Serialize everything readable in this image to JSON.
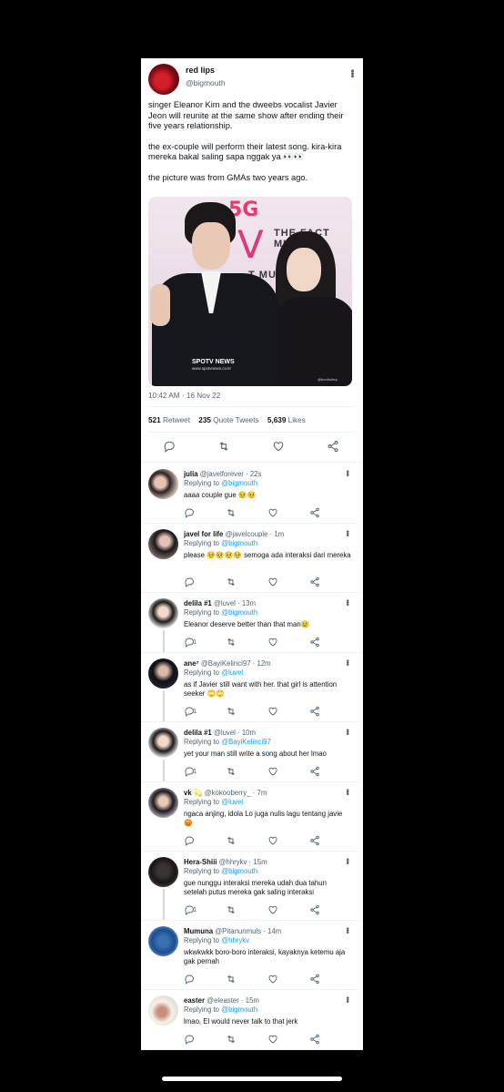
{
  "tweet": {
    "display_name": "red lips",
    "handle": "@bigmouth",
    "paragraphs": [
      "singer Eleanor Kim and the dweebs vocalist Javier Jeon will reunite at the same show after ending their five years relationship.",
      "the ex-couple will perform their latest song. kira-kira mereka bakal saling sapa nggak ya 👀👀",
      "the picture was from GMAs two years ago."
    ],
    "photo": {
      "logo_5g": "5G",
      "logo_v": "V",
      "backdrop_text_1": "THE FACT MUS",
      "backdrop_text_2": "T MUSI",
      "caption": "SPOTV NEWS",
      "caption_sub": "www.spotvnews.co.kr",
      "credit": "@bonfruitep"
    },
    "timestamp": "10:42 AM · 16 Nov 22",
    "stats": {
      "retweets": "521",
      "retweets_label": "Retweet",
      "quotes": "235",
      "quotes_label": "Quote Tweets",
      "likes": "5,639",
      "likes_label": "Likes"
    }
  },
  "replies": [
    {
      "name": "julia",
      "handle": "@javelforever",
      "time": "· 22s",
      "replying_prefix": "Replying to",
      "replying_to": "@bigmouth",
      "text": "aaaa couple gue 🥺🥺",
      "reply_count": ""
    },
    {
      "name": "javel for life",
      "handle": "@javelcouple",
      "time": "· 1m",
      "replying_prefix": "Replying to",
      "replying_to": "@bigmouth",
      "text": "please 🥺🥺🥺🥺 semoga ada interaksi dari mereka",
      "reply_count": ""
    },
    {
      "name": "delila #1",
      "handle": "@luvel",
      "time": "· 13m",
      "replying_prefix": "Replying to",
      "replying_to": "@bigmouth",
      "text": "Eleanor deserve better than that man😢",
      "reply_count": "1"
    },
    {
      "name": "ane⁷",
      "handle": "@BayiKelinci97",
      "time": "· 12m",
      "replying_prefix": "Replying to",
      "replying_to": "@luvel",
      "text": "as if Javier still want with her. that girl is attention seeker 🙄🙄",
      "reply_count": "1"
    },
    {
      "name": "delila #1",
      "handle": "@luvel",
      "time": "· 10m",
      "replying_prefix": "Replying to",
      "replying_to": "@BayiKelinci97",
      "text": "yet your man still write a song about her lmao",
      "reply_count": "1"
    },
    {
      "name": "vk 💫",
      "handle": "@kokooberry_",
      "time": "· 7m",
      "replying_prefix": "Replying to",
      "replying_to": "@luvel",
      "text": "ngaca anjing, idola Lo juga nulis lagu tentang javie 😡",
      "reply_count": ""
    },
    {
      "name": "Hera-Shiii",
      "handle": "@hhrykv",
      "time": "· 15m",
      "replying_prefix": "Replying to",
      "replying_to": "@bigmouth",
      "text": "gue nunggu interaksi mereka udah dua tahun setelah putus mereka gak saling interaksi",
      "reply_count": "1"
    },
    {
      "name": "Mumuna",
      "handle": "@Pitanunmuls",
      "time": "· 14m",
      "replying_prefix": "Replying to",
      "replying_to": "@hhrykv",
      "text": "wkwkwkk boro-boro interaksi, kayaknya ketemu aja gak pernah",
      "reply_count": ""
    },
    {
      "name": "easter",
      "handle": "@eleaster",
      "time": "· 15m",
      "replying_prefix": "Replying to",
      "replying_to": "@bigmouth",
      "text": "lmao, El would never talk to that jerk",
      "reply_count": ""
    }
  ],
  "icons": {
    "reply": "reply-icon",
    "retweet": "retweet-icon",
    "like": "like-icon",
    "share": "share-icon",
    "more": "more-icon"
  }
}
